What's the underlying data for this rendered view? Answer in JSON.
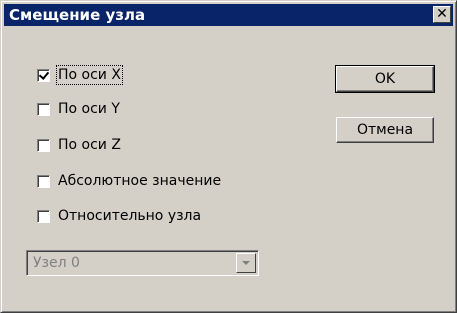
{
  "dialog": {
    "title": "Смещение узла",
    "close_label": "✕"
  },
  "options": [
    {
      "label": "По оси X",
      "checked": true
    },
    {
      "label": "По оси Y",
      "checked": false
    },
    {
      "label": "По оси Z",
      "checked": false
    },
    {
      "label": "Абсолютное значение",
      "checked": false
    },
    {
      "label": "Относительно узла",
      "checked": false
    }
  ],
  "buttons": {
    "ok_label": "OK",
    "cancel_label": "Отмена"
  },
  "node_select": {
    "value": "Узел 0",
    "disabled": true
  }
}
